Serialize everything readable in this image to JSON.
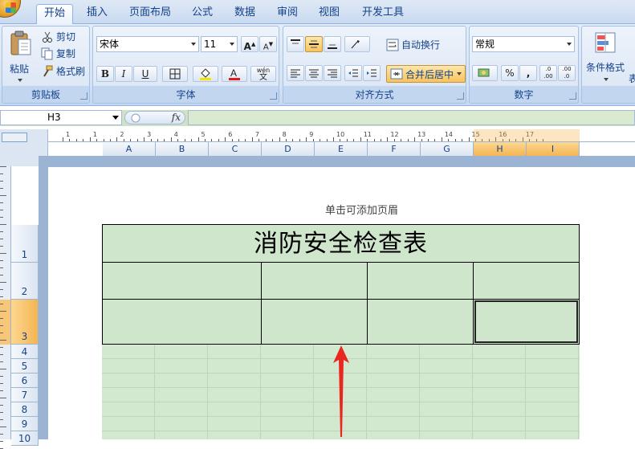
{
  "tabs": [
    {
      "label": "开始",
      "active": true
    },
    {
      "label": "插入"
    },
    {
      "label": "页面布局"
    },
    {
      "label": "公式"
    },
    {
      "label": "数据"
    },
    {
      "label": "审阅"
    },
    {
      "label": "视图"
    },
    {
      "label": "开发工具"
    }
  ],
  "clipboard": {
    "paste": "粘贴",
    "cut": "剪切",
    "copy": "复制",
    "format_painter": "格式刷",
    "title": "剪贴板"
  },
  "font": {
    "name": "宋体",
    "size": "11",
    "title": "字体",
    "grow": "A",
    "shrink": "A",
    "bold": "B",
    "italic": "I",
    "underline": "U",
    "phonetic": "wén"
  },
  "alignment": {
    "wrap": "自动换行",
    "merge": "合并后居中",
    "title": "对齐方式"
  },
  "number": {
    "format": "常规",
    "percent": "%",
    "comma": ",",
    "inc_decimal": ".0 .00",
    "dec_decimal": ".00 .0",
    "title": "数字"
  },
  "styles": {
    "conditional": "条件格式",
    "partial": "表"
  },
  "formula_bar": {
    "cell_ref": "H3",
    "fx": "fx",
    "content": ""
  },
  "ruler": {
    "marks": [
      "1",
      "1",
      "2",
      "3",
      "4",
      "5",
      "6",
      "7",
      "8",
      "9",
      "10",
      "11",
      "12",
      "13",
      "14",
      "15",
      "16",
      "17"
    ]
  },
  "columns": [
    {
      "label": "A",
      "selected": false
    },
    {
      "label": "B",
      "selected": false
    },
    {
      "label": "C",
      "selected": false
    },
    {
      "label": "D",
      "selected": false
    },
    {
      "label": "E",
      "selected": false
    },
    {
      "label": "F",
      "selected": false
    },
    {
      "label": "G",
      "selected": false
    },
    {
      "label": "H",
      "selected": true
    },
    {
      "label": "I",
      "selected": true
    }
  ],
  "rows": [
    {
      "label": "1",
      "selected": false
    },
    {
      "label": "2",
      "selected": false
    },
    {
      "label": "3",
      "selected": true
    },
    {
      "label": "4",
      "selected": false
    },
    {
      "label": "5",
      "selected": false
    },
    {
      "label": "6",
      "selected": false
    },
    {
      "label": "7",
      "selected": false
    },
    {
      "label": "8",
      "selected": false
    },
    {
      "label": "9",
      "selected": false
    },
    {
      "label": "10",
      "selected": false
    }
  ],
  "page": {
    "header_hint": "单击可添加页眉",
    "table_title": "消防安全检查表"
  },
  "colors": {
    "selection": "#f4b552",
    "sheet_fill": "#cfe6cd",
    "arrow": "#e8281e"
  }
}
